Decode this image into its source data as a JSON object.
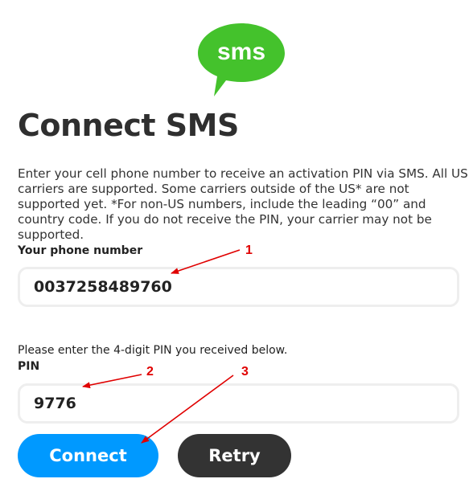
{
  "logo": {
    "text": "sms",
    "color": "#44c22c"
  },
  "page": {
    "title": "Connect SMS",
    "description": "Enter your cell phone number to receive an activation PIN via SMS. All US carriers are supported. Some carriers outside of the US* are not supported yet. *For non-US numbers, include the leading “00” and country code. If you do not receive the PIN, your carrier may not be supported."
  },
  "phone": {
    "label": "Your phone number",
    "value": "0037258489760"
  },
  "pin": {
    "hint": "Please enter the 4-digit PIN you received below.",
    "label": "PIN",
    "value": "9776"
  },
  "buttons": {
    "connect_label": "Connect",
    "retry_label": "Retry"
  },
  "annotations": {
    "one": "1",
    "two": "2",
    "three": "3",
    "color": "#e00000"
  },
  "colors": {
    "primary": "#0099ff",
    "secondary": "#333333",
    "field_border": "#eeeeee"
  }
}
